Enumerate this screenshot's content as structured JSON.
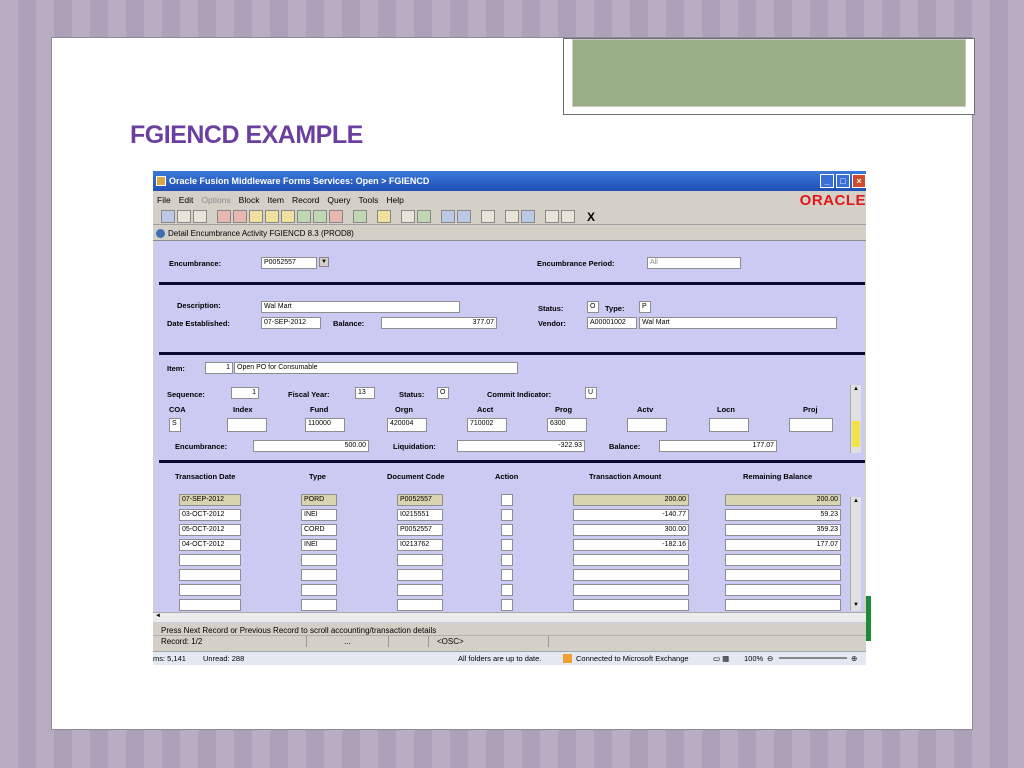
{
  "slide": {
    "title": "FGIENCD EXAMPLE"
  },
  "window": {
    "title": "Oracle Fusion Middleware Forms Services:  Open > FGIENCD",
    "min_glyph": "_",
    "max_glyph": "□",
    "close_glyph": "×",
    "oracle_logo": "ORACLE"
  },
  "menu": [
    {
      "label": "File",
      "enabled": true
    },
    {
      "label": "Edit",
      "enabled": true
    },
    {
      "label": "Options",
      "enabled": false
    },
    {
      "label": "Block",
      "enabled": true
    },
    {
      "label": "Item",
      "enabled": true
    },
    {
      "label": "Record",
      "enabled": true
    },
    {
      "label": "Query",
      "enabled": true
    },
    {
      "label": "Tools",
      "enabled": true
    },
    {
      "label": "Help",
      "enabled": true
    }
  ],
  "toolbar": {
    "exit_glyph": "X"
  },
  "form": {
    "title": "Detail Encumbrance Activity  FGIENCD  8.3  (PROD8)"
  },
  "key": {
    "encumbrance_label": "Encumbrance:",
    "encumbrance_value": "P0052557",
    "period_label": "Encumbrance Period:",
    "period_value": "All"
  },
  "header": {
    "description_label": "Description:",
    "description": "Wal Mart",
    "status_label": "Status:",
    "status": "O",
    "type_label": "Type:",
    "type": "P",
    "date_label": "Date Established:",
    "date": "07-SEP-2012",
    "balance_label": "Balance:",
    "balance": "377.07",
    "vendor_label": "Vendor:",
    "vendor_id": "A00001002",
    "vendor_name": "Wal Mart"
  },
  "item": {
    "item_label": "Item:",
    "item_no": "1",
    "item_desc": "Open PO for Consumable",
    "sequence_label": "Sequence:",
    "sequence": "1",
    "fiscal_year_label": "Fiscal Year:",
    "fiscal_year": "13",
    "status_label": "Status:",
    "status": "O",
    "commit_label": "Commit Indicator:",
    "commit": "U",
    "coa_headers": [
      "COA",
      "Index",
      "Fund",
      "Orgn",
      "Acct",
      "Prog",
      "Actv",
      "Locn",
      "Proj"
    ],
    "coa_values": [
      "S",
      "",
      "110000",
      "420004",
      "710002",
      "6300",
      "",
      "",
      ""
    ],
    "enc_label": "Encumbrance:",
    "enc": "500.00",
    "liq_label": "Liquidation:",
    "liq": "-322.93",
    "bal_label": "Balance:",
    "bal": "177.07"
  },
  "transactions": {
    "headers": [
      "Transaction Date",
      "Type",
      "Document Code",
      "Action",
      "Transaction Amount",
      "Remaining Balance"
    ],
    "rows": [
      {
        "date": "07-SEP-2012",
        "type": "PORD",
        "doc": "P0052557",
        "action": "",
        "amount": "200.00",
        "remaining": "200.00"
      },
      {
        "date": "03-OCT-2012",
        "type": "INEI",
        "doc": "I0215551",
        "action": "",
        "amount": "-140.77",
        "remaining": "59.23"
      },
      {
        "date": "05-OCT-2012",
        "type": "CORD",
        "doc": "P0052557",
        "action": "",
        "amount": "300.00",
        "remaining": "359.23"
      },
      {
        "date": "04-OCT-2012",
        "type": "INEI",
        "doc": "I0213762",
        "action": "",
        "amount": "-182.16",
        "remaining": "177.07"
      },
      {
        "date": "",
        "type": "",
        "doc": "",
        "action": "",
        "amount": "",
        "remaining": ""
      },
      {
        "date": "",
        "type": "",
        "doc": "",
        "action": "",
        "amount": "",
        "remaining": ""
      },
      {
        "date": "",
        "type": "",
        "doc": "",
        "action": "",
        "amount": "",
        "remaining": ""
      },
      {
        "date": "",
        "type": "",
        "doc": "",
        "action": "",
        "amount": "",
        "remaining": ""
      }
    ]
  },
  "status": {
    "message": "Press Next Record or Previous Record to scroll accounting/transaction details",
    "record": "Record: 1/2",
    "ellipsis": "...",
    "osc": "<OSC>"
  },
  "outlook": {
    "items": "ms: 5,141",
    "unread": "Unread: 288",
    "folders": "All folders are up to date.",
    "exchange": "Connected to Microsoft Exchange",
    "zoom": "100%"
  }
}
